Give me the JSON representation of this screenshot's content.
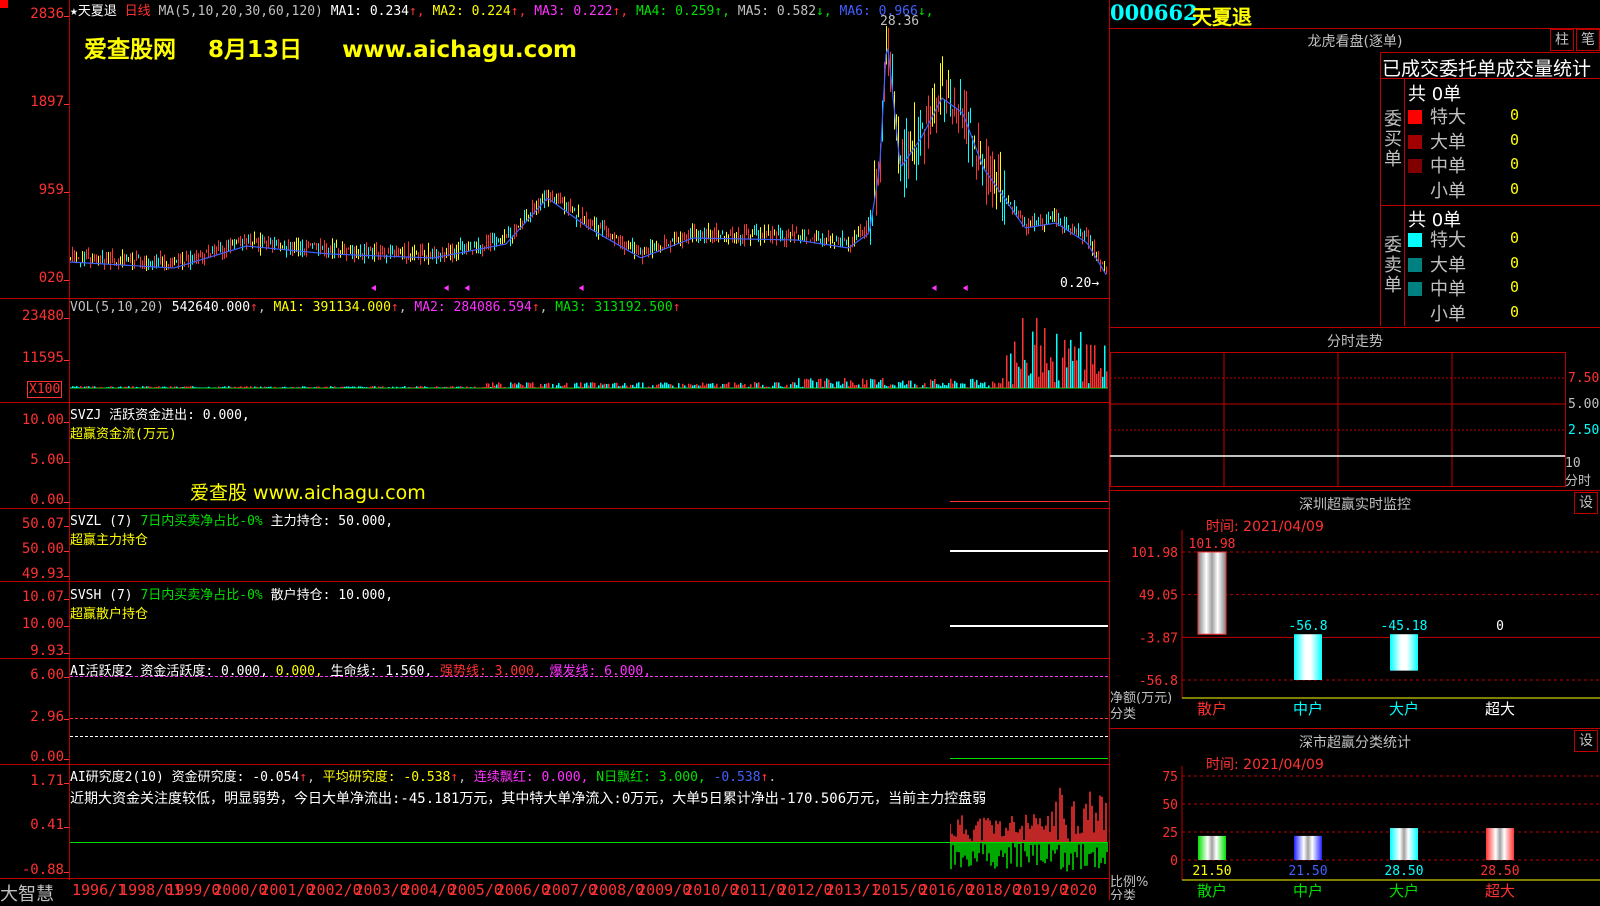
{
  "chart": {
    "title_marker": "★天夏退",
    "period": "日线",
    "ma_header": {
      "label": "MA(5,10,20,30,60,120)",
      "items": [
        {
          "name": "MA1:",
          "value": "0.234",
          "color": "#ffffff"
        },
        {
          "name": "MA2:",
          "value": "0.224",
          "color": "#ffff00"
        },
        {
          "name": "MA3:",
          "value": "0.222",
          "color": "#ff32ff"
        },
        {
          "name": "MA4:",
          "value": "0.259",
          "color": "#00e000"
        },
        {
          "name": "MA5:",
          "value": "0.582",
          "color": "#c0c0c0"
        },
        {
          "name": "MA6:",
          "value": "0.966",
          "color": "#4060ff"
        }
      ]
    },
    "watermark1": "爱查股网    8月13日     www.aichagu.com",
    "watermark2": "爱查股 www.aichagu.com",
    "price_axis": [
      "2836",
      "1897",
      "959",
      "020"
    ],
    "peak_label": "28.36",
    "last_label": "0.20",
    "vol_header": {
      "label": "VOL(5,10,20)",
      "v": "542640.000",
      "ma1": "MA1: 391134.000",
      "ma2": "MA2: 284086.594",
      "ma3": "MA3: 313192.500"
    },
    "vol_axis": [
      "23480",
      "11595"
    ],
    "vol_unit": "X100",
    "svzj": {
      "line1": "SVZJ  活跃资金进出: 0.000,",
      "line2": "超赢资金流(万元)",
      "axis": [
        "10.00",
        "5.00",
        "0.00"
      ]
    },
    "svzl": {
      "prefix": "SVZL (7)",
      "desc": "7日内买卖净占比-0%",
      "value": "主力持仓: 50.000,",
      "line2": "超赢主力持仓",
      "axis": [
        "50.07",
        "50.00",
        "49.93"
      ]
    },
    "svsh": {
      "prefix": "SVSH (7)",
      "desc": "7日内买卖净占比-0%",
      "value": "散户持仓: 10.000,",
      "line2": "超赢散户持仓",
      "axis": [
        "10.07",
        "10.00",
        "9.93"
      ]
    },
    "ai_active": {
      "prefix": "AI活跃度2",
      "a": "资金活跃度: 0.000,",
      "b": "0.000,",
      "c": "生命线: 1.560,",
      "d": "强势线: 3.000,",
      "e": "爆发线: 6.000,",
      "axis": [
        "6.00",
        "2.96",
        "0.00"
      ]
    },
    "ai_research": {
      "prefix": "AI研究度2(10)",
      "a": "资金研究度: -0.054",
      "b": "平均研究度: -0.538",
      "c": "连续飘红: 0.000,",
      "d": "N日飘红: 3.000,",
      "e": "-0.538",
      "comment": "近期大资金关注度较低，明显弱势，今日大单净流出:-45.181万元，其中特大单净流入:0万元，大单5日累计净出-170.506万元，当前主力控盘弱",
      "axis": [
        "1.71",
        "0.41",
        "-0.88"
      ]
    },
    "brand": "大智慧",
    "years": [
      "1996/1",
      "1998/01",
      "1999/0",
      "2000/0",
      "2001/0",
      "2002/0",
      "2003/0",
      "2004/0",
      "2005/0",
      "2006/0",
      "2007/0",
      "2008/0",
      "2009/0",
      "2010/0",
      "2011/0",
      "2012/0",
      "2013/1",
      "2015/0",
      "2016/0",
      "2018/0",
      "2019/0",
      "2020"
    ]
  },
  "right": {
    "code": "000662",
    "name": "天夏退",
    "lhb": {
      "title": "龙虎看盘(逐单)",
      "btn1": "柱",
      "btn2": "笔",
      "stats_title": "已成交委托单成交量统计",
      "buy": {
        "label": "委买单",
        "total": "共 0单",
        "rows": [
          {
            "name": "特大",
            "value": "0",
            "color": "#ff0000"
          },
          {
            "name": "大单",
            "value": "0",
            "color": "#a00000"
          },
          {
            "name": "中单",
            "value": "0",
            "color": "#800000"
          },
          {
            "name": "小单",
            "value": "0",
            "color": ""
          }
        ]
      },
      "sell": {
        "label": "委卖单",
        "total": "共 0单",
        "rows": [
          {
            "name": "特大",
            "value": "0",
            "color": "#00ffff"
          },
          {
            "name": "大单",
            "value": "0",
            "color": "#008080"
          },
          {
            "name": "中单",
            "value": "0",
            "color": "#008080"
          },
          {
            "name": "小单",
            "value": "0",
            "color": ""
          }
        ]
      }
    },
    "intraday": {
      "title": "分时走势",
      "axis": [
        "7.50",
        "5.00",
        "2.50",
        "10",
        "分时"
      ]
    },
    "monitor": {
      "title": "深圳超赢实时监控",
      "btn": "设",
      "time": "时间: 2021/04/09",
      "axis": [
        "101.98",
        "49.05",
        "-3.87",
        "-56.8"
      ],
      "unit": "净额(万元)",
      "unit2": "分类",
      "bars": [
        {
          "label": "散户",
          "value": 101.98,
          "text": "101.98",
          "color": "#ff3232"
        },
        {
          "label": "中户",
          "value": -56.8,
          "text": "-56.8",
          "color": "#00ffff"
        },
        {
          "label": "大户",
          "value": -45.18,
          "text": "-45.18",
          "color": "#00ffff"
        },
        {
          "label": "超大",
          "value": 0,
          "text": "0",
          "color": "#ffffff"
        }
      ]
    },
    "classify": {
      "title": "深市超赢分类统计",
      "btn": "设",
      "time": "时间: 2021/04/09",
      "axis": [
        "75",
        "50",
        "25",
        "0"
      ],
      "unit": "比例%",
      "unit2": "分类",
      "bars": [
        {
          "label": "散户",
          "value": 21.5,
          "text": "21.50",
          "color": "#00e000"
        },
        {
          "label": "中户",
          "value": 21.5,
          "text": "21.50",
          "color": "#2020ff"
        },
        {
          "label": "大户",
          "value": 28.5,
          "text": "28.50",
          "color": "#00ffff"
        },
        {
          "label": "超大",
          "value": 28.5,
          "text": "28.50",
          "color": "#ff3232"
        }
      ]
    }
  },
  "colors": {
    "grid": "#c00000",
    "up": "#ff3232",
    "down": "#00ffff",
    "accent": "#ffff00"
  }
}
